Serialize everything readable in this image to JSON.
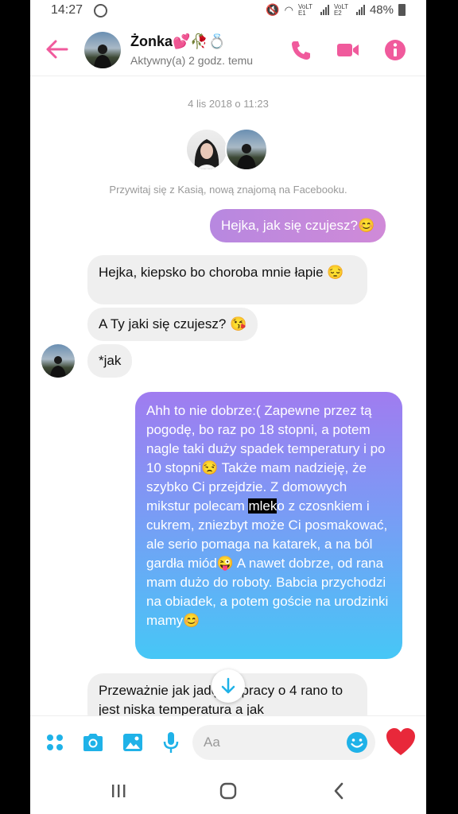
{
  "status_bar": {
    "time": "14:27",
    "net1": "VoLTE1",
    "net2": "VoLTE2",
    "battery": "48%"
  },
  "header": {
    "contact_name": "Żonka💕🥀💍",
    "contact_status": "Aktywny(a) 2 godz. temu"
  },
  "chat": {
    "date": "4 lis 2018 o 11:23",
    "intro": "Przywitaj się z Kasią, nową znajomą na Facebooku.",
    "messages": [
      {
        "dir": "out",
        "text": "Hejka, jak się czujesz?😊"
      },
      {
        "dir": "in",
        "text": "Hejka, kiepsko bo choroba mnie łapie 😔"
      },
      {
        "dir": "in",
        "text": "A Ty jaki się czujesz? 😘"
      },
      {
        "dir": "in",
        "text": "*jak"
      },
      {
        "dir": "out",
        "text_before": "Ahh to nie dobrze:( Zapewne przez tą pogodę, bo raz po 18 stopni, a potem nagle taki duży spadek temperatury i po 10 stopni😒 Także mam nadzieję, że szybko Ci przejdzie. Z domowych mikstur polecam ",
        "highlight": "mlek",
        "text_after": "o z czosnkiem i cukrem, zniezbyt może Ci posmakować, ale serio pomaga na katarek, a na ból gardła miód😜 A nawet dobrze, od rana mam dużo do roboty. Babcia przychodzi na obiadek, a potem goście na urodzinki mamy😊"
      },
      {
        "dir": "in",
        "text": "Przeważnie jak jadę do pracy o 4 rano to jest niska temperatura a jak"
      }
    ]
  },
  "composer": {
    "placeholder": "Aa"
  },
  "colors": {
    "accent": "#f05a9c",
    "messenger_blue": "#1fb2e8",
    "like_heart": "#e8283a"
  },
  "icons": {
    "header": [
      "back-arrow-icon",
      "phone-icon",
      "video-camera-icon",
      "info-icon"
    ],
    "composer": [
      "menu-dots-icon",
      "camera-icon",
      "image-icon",
      "microphone-icon",
      "emoji-icon",
      "heart-icon"
    ],
    "nav": [
      "recent-apps-icon",
      "home-icon",
      "back-icon"
    ]
  }
}
